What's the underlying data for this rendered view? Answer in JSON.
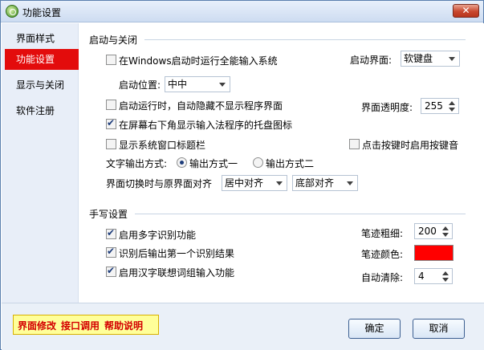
{
  "window": {
    "title": "功能设置",
    "close_label": "✕"
  },
  "sidebar": {
    "items": [
      {
        "label": "界面样式",
        "active": false
      },
      {
        "label": "功能设置",
        "active": true
      },
      {
        "label": "显示与关闭",
        "active": false
      },
      {
        "label": "软件注册",
        "active": false
      }
    ]
  },
  "startup": {
    "section_title": "启动与关闭",
    "run_on_windows": {
      "label": "在Windows启动时运行全能输入系统",
      "checked": false
    },
    "startup_screen": {
      "label": "启动界面:",
      "value": "软键盘"
    },
    "startup_position": {
      "label": "启动位置:",
      "value": "中中"
    },
    "auto_hide": {
      "label": "启动运行时，自动隐藏不显示程序界面",
      "checked": false
    },
    "opacity": {
      "label": "界面透明度:",
      "value": "255"
    },
    "tray_icon": {
      "label": "在屏幕右下角显示输入法程序的托盘图标",
      "checked": true
    },
    "show_titlebar": {
      "label": "显示系统窗口标题栏",
      "checked": false
    },
    "key_sound": {
      "label": "点击按键时启用按键音",
      "checked": false
    },
    "text_output": {
      "label": "文字输出方式:",
      "option1": "输出方式一",
      "option2": "输出方式二",
      "selected": "option1"
    },
    "align": {
      "label": "界面切换时与原界面对齐",
      "horizontal": "居中对齐",
      "vertical": "底部对齐"
    }
  },
  "handwriting": {
    "section_title": "手写设置",
    "multi_char": {
      "label": "启用多字识别功能",
      "checked": true
    },
    "output_first": {
      "label": "识别后输出第一个识别结果",
      "checked": true
    },
    "association": {
      "label": "启用汉字联想词组输入功能",
      "checked": true
    },
    "stroke_width": {
      "label": "笔迹粗细:",
      "value": "200"
    },
    "stroke_color": {
      "label": "笔迹颜色:",
      "color": "#ff0000"
    },
    "auto_clear": {
      "label": "自动清除:",
      "value": "4"
    }
  },
  "footer": {
    "links": [
      "界面修改",
      "接口调用",
      "帮助说明"
    ],
    "ok_label": "确定",
    "cancel_label": "取消"
  }
}
